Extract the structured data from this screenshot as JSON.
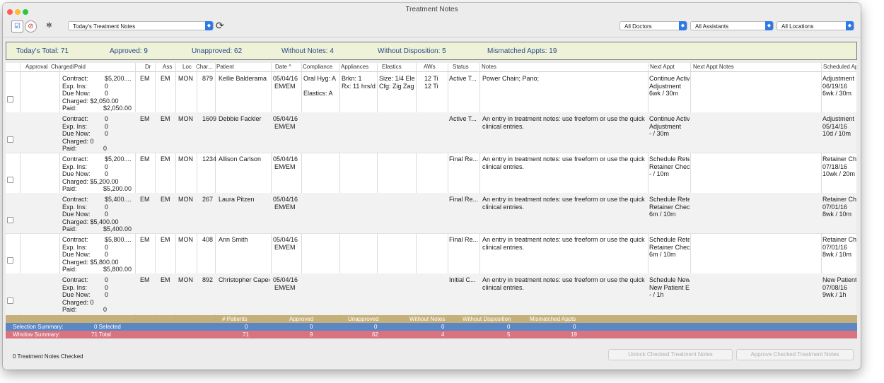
{
  "window": {
    "title": "Treatment Notes"
  },
  "toolbar": {
    "view_select": "Today's Treatment Notes",
    "doctors": "All Doctors",
    "assistants": "All Assistants",
    "locations": "All Locations"
  },
  "totals": {
    "today": "Today's Total:  71",
    "approved": "Approved:  9",
    "unapproved": "Unapproved:  62",
    "without_notes": "Without Notes:  4",
    "without_disposition": "Without Disposition:  5",
    "mismatched": "Mismatched Appts:  19"
  },
  "columns": [
    "Approval",
    "Charged/Paid",
    "Dr",
    "Ass",
    "Loc",
    "Char...",
    "Patient",
    "Date  ^",
    "Compliance",
    "Appliances",
    "Elastics",
    "AWs",
    "Status",
    "Notes",
    "Next Appt",
    "Next Appt Notes",
    "Scheduled Appt"
  ],
  "rows": [
    {
      "contract": "$5,200....",
      "exp": "0",
      "due": "0",
      "charged": "Charged: $2,050.00",
      "paid": "$2,050.00",
      "dr": "EM",
      "ass": "EM",
      "loc": "MON",
      "chart": "879",
      "patient": "Kellie Balderama",
      "date1": "05/04/16",
      "date2": "EM/EM",
      "comp1": "Oral Hyg: A",
      "comp2": "Elastics:  A",
      "app1": "Brkn:      1",
      "app2": "Rx:  11 hrs/d",
      "el1": "Size: 1/4 Ele",
      "el2": "Cfg: Zig Zag",
      "aw1": "12 Ti",
      "aw2": "12 Ti",
      "status": "Active T...",
      "note1": "Power Chain; Pano;",
      "note2": "",
      "na1": "Continue Activ",
      "na2": "Adjustment",
      "na3": "6wk / 30m",
      "sa1": "Adjustment",
      "sa2": "06/19/16",
      "sa3": "6wk / 30m"
    },
    {
      "contract": "0",
      "exp": "0",
      "due": "0",
      "charged": "Charged: 0",
      "paid": "0",
      "dr": "EM",
      "ass": "EM",
      "loc": "MON",
      "chart": "1609",
      "patient": "Debbie Fackler",
      "date1": "05/04/16",
      "date2": "EM/EM",
      "comp1": "",
      "comp2": "",
      "app1": "",
      "app2": "",
      "el1": "",
      "el2": "",
      "aw1": "",
      "aw2": "",
      "status": "Active T...",
      "note1": "An entry in treatment notes: use freeform or use the quick",
      "note2": "clinical entries.",
      "na1": "Continue Activ",
      "na2": "Adjustment",
      "na3": "- / 30m",
      "sa1": "Adjustment",
      "sa2": "05/14/16",
      "sa3": "10d / 10m"
    },
    {
      "contract": "$5,200....",
      "exp": "0",
      "due": "0",
      "charged": "Charged: $5,200.00",
      "paid": "$5,200.00",
      "dr": "EM",
      "ass": "EM",
      "loc": "MON",
      "chart": "1234",
      "patient": "Allison Carlson",
      "date1": "05/04/16",
      "date2": "EM/EM",
      "comp1": "",
      "comp2": "",
      "app1": "",
      "app2": "",
      "el1": "",
      "el2": "",
      "aw1": "",
      "aw2": "",
      "status": "Final Re...",
      "note1": "An entry in treatment notes: use freeform or use the quick",
      "note2": "clinical entries.",
      "na1": "Schedule Rete",
      "na2": "Retainer Checl",
      "na3": "- / 10m",
      "sa1": "Retainer Check",
      "sa2": "07/18/16",
      "sa3": "10wk / 20m"
    },
    {
      "contract": "$5,400....",
      "exp": "0",
      "due": "0",
      "charged": "Charged: $5,400.00",
      "paid": "$5,400.00",
      "dr": "EM",
      "ass": "EM",
      "loc": "MON",
      "chart": "267",
      "patient": "Laura Pitzen",
      "date1": "05/04/16",
      "date2": "EM/EM",
      "comp1": "",
      "comp2": "",
      "app1": "",
      "app2": "",
      "el1": "",
      "el2": "",
      "aw1": "",
      "aw2": "",
      "status": "Final Re...",
      "note1": "An entry in treatment notes: use freeform or use the quick",
      "note2": "clinical entries.",
      "na1": "Schedule Rete",
      "na2": "Retainer Checl",
      "na3": "6m / 10m",
      "sa1": "Retainer Check",
      "sa2": "07/01/16",
      "sa3": "8wk / 10m"
    },
    {
      "contract": "$5,800....",
      "exp": "0",
      "due": "0",
      "charged": "Charged: $5,800.00",
      "paid": "$5,800.00",
      "dr": "EM",
      "ass": "EM",
      "loc": "MON",
      "chart": "408",
      "patient": "Ann Smith",
      "date1": "05/04/16",
      "date2": "EM/EM",
      "comp1": "",
      "comp2": "",
      "app1": "",
      "app2": "",
      "el1": "",
      "el2": "",
      "aw1": "",
      "aw2": "",
      "status": "Final Re...",
      "note1": "An entry in treatment notes: use freeform or use the quick",
      "note2": "clinical entries.",
      "na1": "Schedule Rete",
      "na2": "Retainer Checl",
      "na3": "6m / 10m",
      "sa1": "Retainer Check",
      "sa2": "07/01/16",
      "sa3": "8wk / 10m"
    },
    {
      "contract": "0",
      "exp": "0",
      "due": "0",
      "charged": "Charged: 0",
      "paid": "0",
      "dr": "EM",
      "ass": "EM",
      "loc": "MON",
      "chart": "892",
      "patient": "Christopher Capec",
      "date1": "05/04/16",
      "date2": "EM/EM",
      "comp1": "",
      "comp2": "",
      "app1": "",
      "app2": "",
      "el1": "",
      "el2": "",
      "aw1": "",
      "aw2": "",
      "status": "Initial C...",
      "note1": "An entry in treatment notes: use freeform or use the quick",
      "note2": "clinical entries.",
      "na1": "Schedule New",
      "na2": "New Patient Ex",
      "na3": "- / 1h",
      "sa1": "New Patient Exam",
      "sa2": "07/08/16",
      "sa3": "9wk / 1h"
    }
  ],
  "labels": {
    "contract": "Contract:",
    "exp": "Exp. Ins:",
    "due": "Due Now:",
    "paid": "Paid:"
  },
  "summary": {
    "headers": [
      "# Patients",
      "Approved",
      "Unapproved",
      "Without Notes",
      "Without Disposition",
      "Mismatched Appts"
    ],
    "selection_label": "Selection Summary:",
    "selection_count": "0  Selected",
    "selection_values": [
      "0",
      "0",
      "0",
      "0",
      "0",
      "0"
    ],
    "window_label": "Window Summary:",
    "window_count": "71  Total",
    "window_values": [
      "71",
      "9",
      "62",
      "4",
      "5",
      "19"
    ]
  },
  "footer": {
    "checked": "0 Treatment Notes Checked",
    "unlock": "Unlock Checked Treatment Notes",
    "approve": "Approve Checked Treatment Notes"
  },
  "colors": {
    "summary_header": "#c6b07a",
    "selection": "#5b87c5",
    "window": "#d9737f",
    "totals_bg": "#eef2d8"
  }
}
